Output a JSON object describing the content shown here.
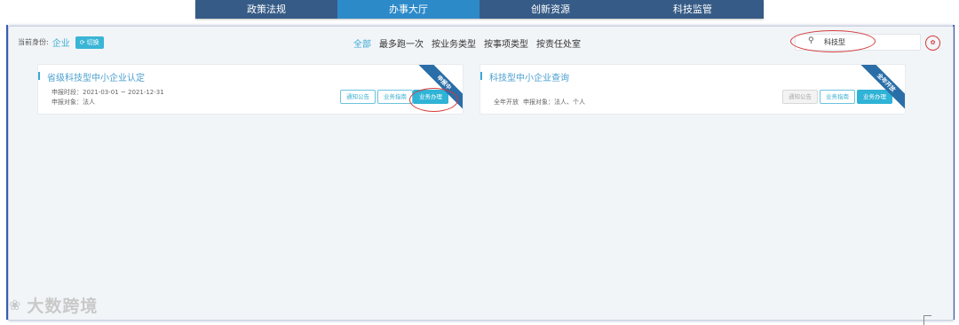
{
  "topnav": {
    "tabs": [
      {
        "label": "政策法规"
      },
      {
        "label": "办事大厅"
      },
      {
        "label": "创新资源"
      },
      {
        "label": "科技监管"
      }
    ],
    "active_index": 1
  },
  "identity": {
    "label": "当前身份:",
    "value": "企业",
    "switch_label": "切换"
  },
  "filters": [
    "全部",
    "最多跑一次",
    "按业务类型",
    "按事项类型",
    "按责任处室"
  ],
  "search": {
    "value": "科技型"
  },
  "cards": [
    {
      "title": "省级科技型中小企业认定",
      "period": "申报时段：2021-03-01 ~ 2021-12-31",
      "target": "申报对象：法人",
      "ribbon": "申报中",
      "buttons": [
        "通知公告",
        "业务指南",
        "业务办理"
      ]
    },
    {
      "title": "科技型中小企业查询",
      "period": "全年开放",
      "target": "申报对象：法人、个人",
      "ribbon": "全年开放",
      "buttons": [
        "通知公告",
        "业务指南",
        "业务办理"
      ]
    }
  ],
  "watermark": {
    "text": "大数跨境"
  },
  "colors": {
    "nav_bg": "#365b86",
    "nav_active": "#2d8ac9",
    "accent": "#3aa9d4",
    "ribbon": "#2a6ea8",
    "annotation_red": "#d43b3b"
  }
}
